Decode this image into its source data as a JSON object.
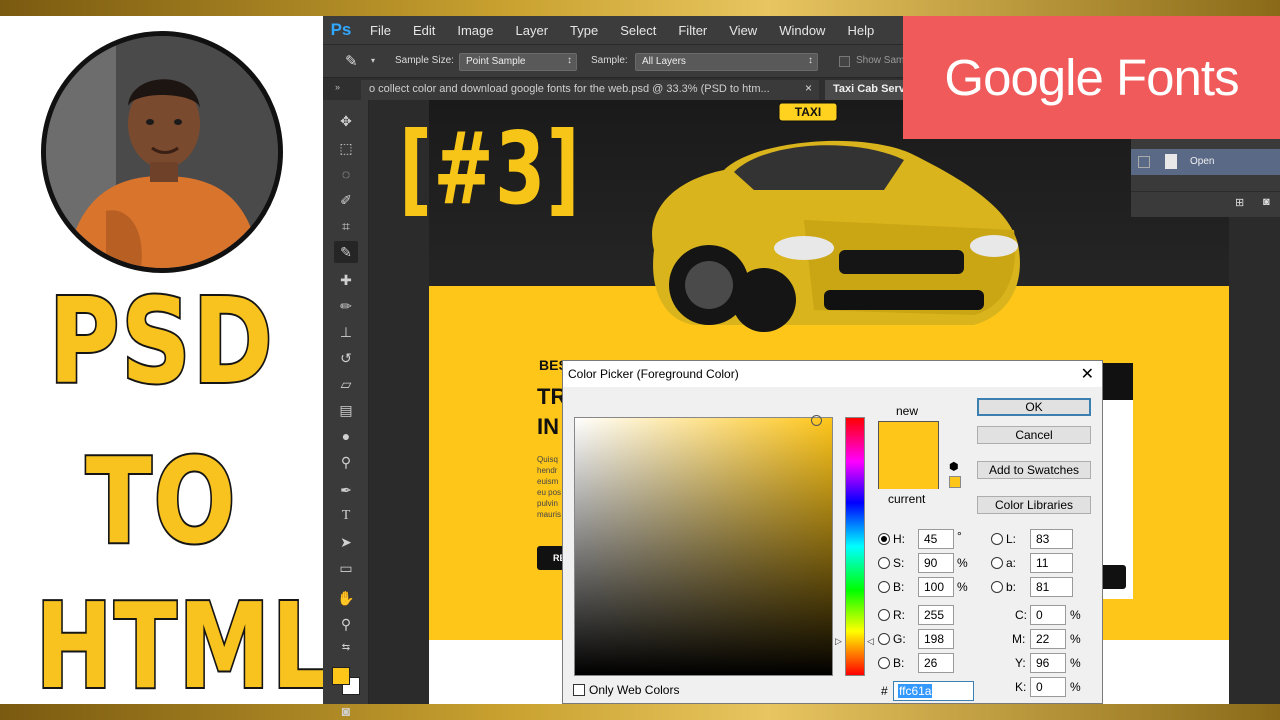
{
  "promo": {
    "line1": "PSD",
    "line2": "TO",
    "line3": "HTML",
    "episode": "[#3]",
    "badge": "Google Fonts"
  },
  "menubar": {
    "logo": "Ps",
    "items": [
      "File",
      "Edit",
      "Image",
      "Layer",
      "Type",
      "Select",
      "Filter",
      "View",
      "Window",
      "Help"
    ]
  },
  "options_bar": {
    "sample_size_label": "Sample Size:",
    "sample_size_value": "Point Sample",
    "sample_label": "Sample:",
    "sample_value": "All Layers",
    "show_sampling_ring_label": "Show Sam"
  },
  "tabs": {
    "active": "o collect color and download google fonts for the web.psd @ 33.3% (PSD  to  htm...",
    "close": "×",
    "second": "Taxi Cab Serv"
  },
  "canvas": {
    "taxi_sign": "TAXI",
    "hero_small": "BES",
    "hero_big": "TR IN",
    "hero_paragraph": "Quisq hendr euism eu pos pulvin mauris",
    "hero_button": "RE"
  },
  "layers": {
    "layer_name": "Open"
  },
  "color_picker": {
    "title": "Color Picker (Foreground Color)",
    "close": "✕",
    "label_new": "new",
    "label_current": "current",
    "buttons": {
      "ok": "OK",
      "cancel": "Cancel",
      "add_to_swatches": "Add to Swatches",
      "color_libraries": "Color Libraries"
    },
    "hsb": {
      "H": "45",
      "S": "90",
      "B": "100"
    },
    "rgb": {
      "R": "255",
      "G": "198",
      "B": "26"
    },
    "lab": {
      "L": "83",
      "a": "11",
      "b": "81"
    },
    "cmyk": {
      "C": "0",
      "M": "22",
      "Y": "96",
      "K": "0"
    },
    "units": {
      "degree": "°",
      "percent": "%"
    },
    "labels": {
      "H": "H:",
      "S": "S:",
      "Bh": "B:",
      "R": "R:",
      "G": "G:",
      "Br": "B:",
      "L": "L:",
      "a": "a:",
      "b": "b:",
      "C": "C:",
      "M": "M:",
      "Y": "Y:",
      "K": "K:",
      "hash": "#"
    },
    "hex": "ffc61a",
    "only_web_colors": "Only Web Colors",
    "selected_color": "#ffc61a",
    "current_color": "#ffc61a"
  },
  "colors": {
    "brand_yellow": "#ffc61a",
    "google_badge": "#f05a5a",
    "photoshop_blue": "#31a8ff"
  }
}
